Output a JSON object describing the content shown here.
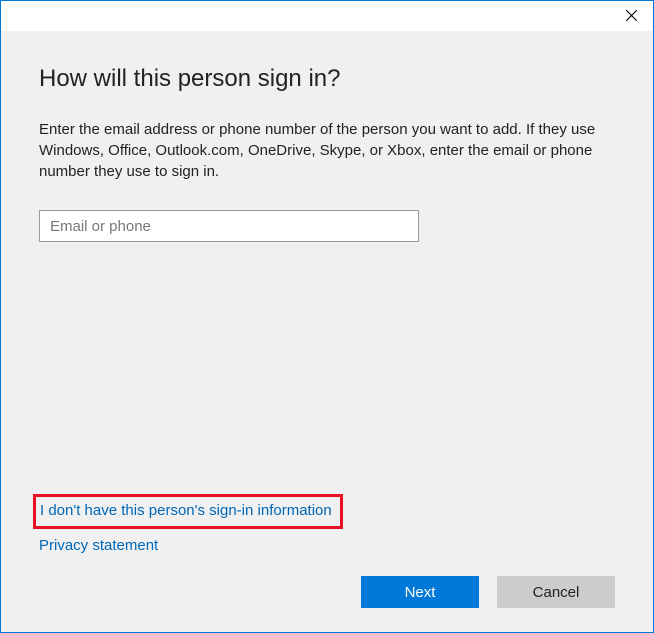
{
  "heading": "How will this person sign in?",
  "description": "Enter the email address or phone number of the person you want to add. If they use Windows, Office, Outlook.com, OneDrive, Skype, or Xbox, enter the email or phone number they use to sign in.",
  "input": {
    "placeholder": "Email or phone",
    "value": ""
  },
  "links": {
    "no_info": "I don't have this person's sign-in information",
    "privacy": "Privacy statement"
  },
  "buttons": {
    "next": "Next",
    "cancel": "Cancel"
  }
}
